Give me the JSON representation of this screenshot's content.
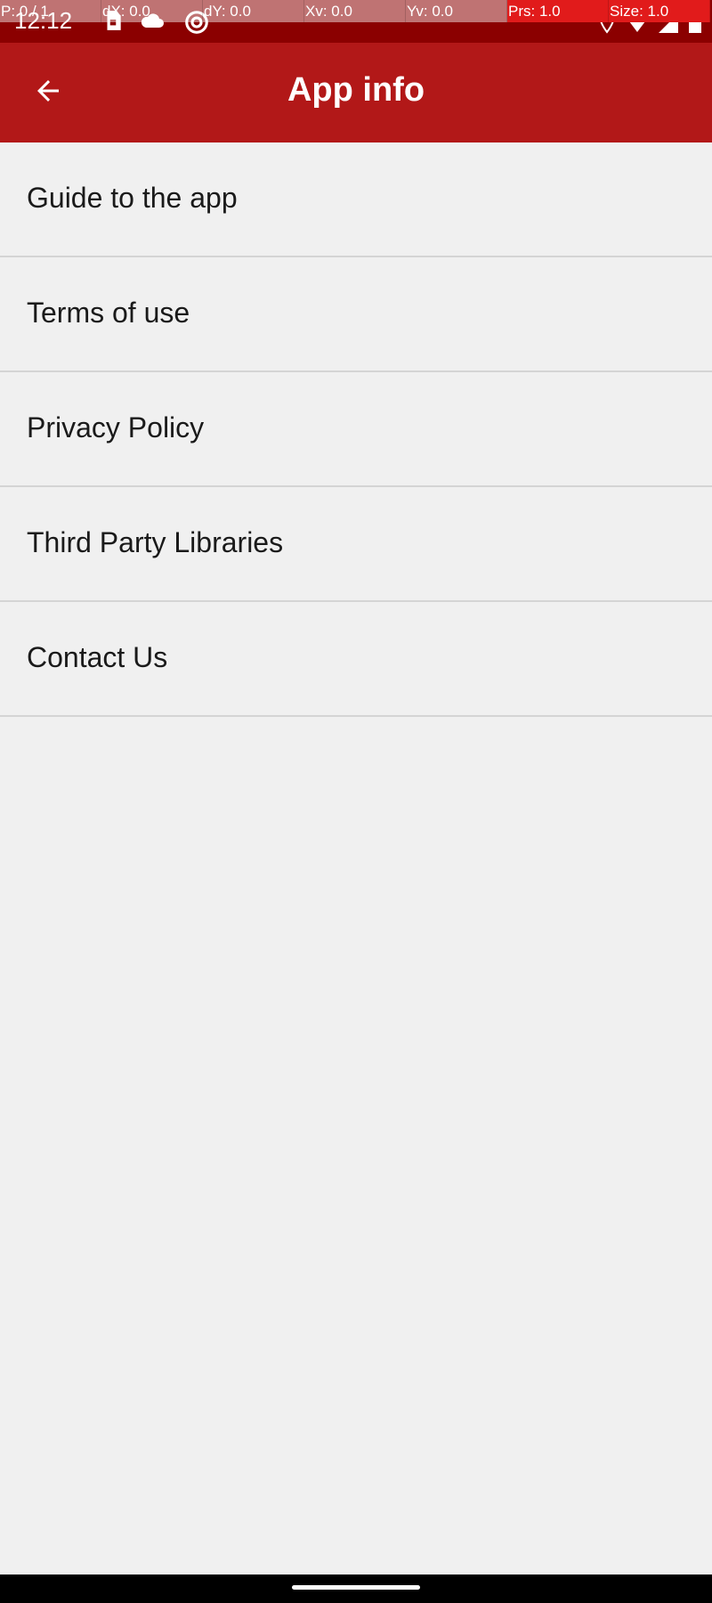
{
  "status_bar": {
    "time": "12:12",
    "icons": [
      "sim-card-icon",
      "cloud-icon",
      "sync-icon",
      "location-icon",
      "wifi-icon",
      "signal-icon",
      "battery-icon"
    ],
    "background": "#8b0000"
  },
  "pointer_overlay": {
    "cells": [
      {
        "label": "P: 0 / 1"
      },
      {
        "label": "dX: 0.0"
      },
      {
        "label": "dY: 0.0"
      },
      {
        "label": "Xv: 0.0"
      },
      {
        "label": "Yv: 0.0"
      },
      {
        "label": "Prs: 1.0"
      },
      {
        "label": "Size: 1.0"
      }
    ]
  },
  "app_bar": {
    "title": "App info",
    "back_icon": "arrow-left-icon",
    "background": "#b21818"
  },
  "menu": {
    "items": [
      {
        "label": "Guide to the app"
      },
      {
        "label": "Terms of use"
      },
      {
        "label": "Privacy Policy"
      },
      {
        "label": "Third Party Libraries"
      },
      {
        "label": "Contact Us"
      }
    ]
  },
  "colors": {
    "background": "#f0f0f0",
    "divider": "#d4d4d4",
    "text": "#1a1a1a"
  }
}
